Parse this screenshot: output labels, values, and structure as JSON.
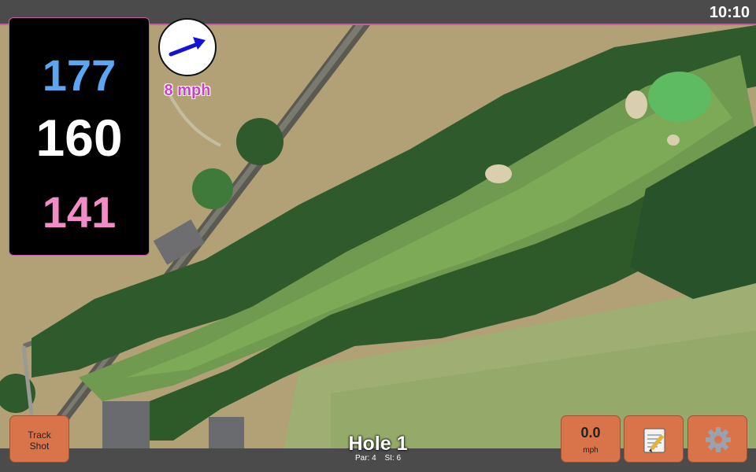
{
  "status_bar": {
    "time": "10:10"
  },
  "distances": {
    "back": {
      "value": "177",
      "color": "#5aa7f0"
    },
    "middle": {
      "value": "160",
      "color": "#ffffff"
    },
    "front": {
      "value": "141",
      "color": "#f28cc6"
    }
  },
  "wind": {
    "speed_label": "8 mph",
    "direction_icon": "arrow-icon"
  },
  "hole": {
    "title": "Hole 1",
    "par": "Par: 4",
    "stroke_index": "SI: 6"
  },
  "buttons": {
    "track_shot_line1": "Track",
    "track_shot_line2": "Shot",
    "wind_speed_value": "0.0",
    "wind_speed_unit": "mph",
    "notes_icon": "notepad-icon",
    "settings_icon": "gear-icon"
  },
  "colors": {
    "accent": "#c65fa8",
    "button": "#d9744a",
    "bar": "#4b4b4b"
  }
}
